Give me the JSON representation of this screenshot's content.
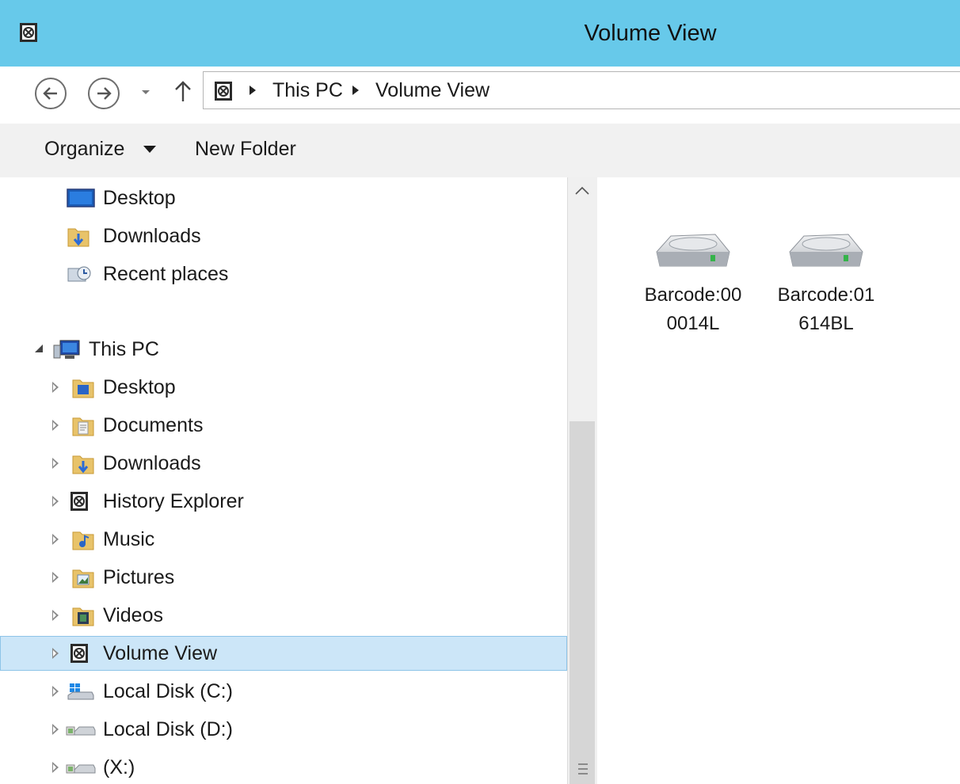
{
  "window": {
    "title": "Volume View",
    "app_icon": "volume-view-icon"
  },
  "navigation": {
    "back_icon": "back-arrow-icon",
    "forward_icon": "forward-arrow-icon",
    "recent_icon": "chevron-down-icon",
    "up_icon": "up-arrow-icon"
  },
  "address": {
    "breadcrumbs": [
      "This PC",
      "Volume View"
    ]
  },
  "toolbar": {
    "organize_label": "Organize",
    "new_folder_label": "New Folder"
  },
  "nav_pane": {
    "favorites": [
      {
        "label": "Desktop",
        "icon": "desktop-icon"
      },
      {
        "label": "Downloads",
        "icon": "downloads-folder-icon"
      },
      {
        "label": "Recent places",
        "icon": "recent-places-icon"
      }
    ],
    "this_pc": {
      "label": "This PC",
      "icon": "computer-icon",
      "expanded": true
    },
    "children": [
      {
        "label": "Desktop",
        "icon": "desktop-folder-icon"
      },
      {
        "label": "Documents",
        "icon": "documents-folder-icon"
      },
      {
        "label": "Downloads",
        "icon": "downloads-folder-icon"
      },
      {
        "label": "History Explorer",
        "icon": "history-explorer-icon"
      },
      {
        "label": "Music",
        "icon": "music-folder-icon"
      },
      {
        "label": "Pictures",
        "icon": "pictures-folder-icon"
      },
      {
        "label": "Videos",
        "icon": "videos-folder-icon"
      },
      {
        "label": "Volume View",
        "icon": "volume-view-icon",
        "selected": true
      },
      {
        "label": "Local Disk (C:)",
        "icon": "system-drive-icon"
      },
      {
        "label": "Local Disk (D:)",
        "icon": "local-disk-icon"
      },
      {
        "label": "(X:)",
        "icon": "local-disk-icon"
      }
    ]
  },
  "content": {
    "items": [
      {
        "label_line1": "Barcode:00",
        "label_line2": "0014L",
        "icon": "hard-drive-icon"
      },
      {
        "label_line1": "Barcode:01",
        "label_line2": "614BL",
        "icon": "hard-drive-icon"
      }
    ]
  },
  "colors": {
    "titlebar": "#67c9ea",
    "toolbar": "#f1f1f1",
    "selection": "#cce6f8",
    "selection_border": "#8ec4e8"
  }
}
